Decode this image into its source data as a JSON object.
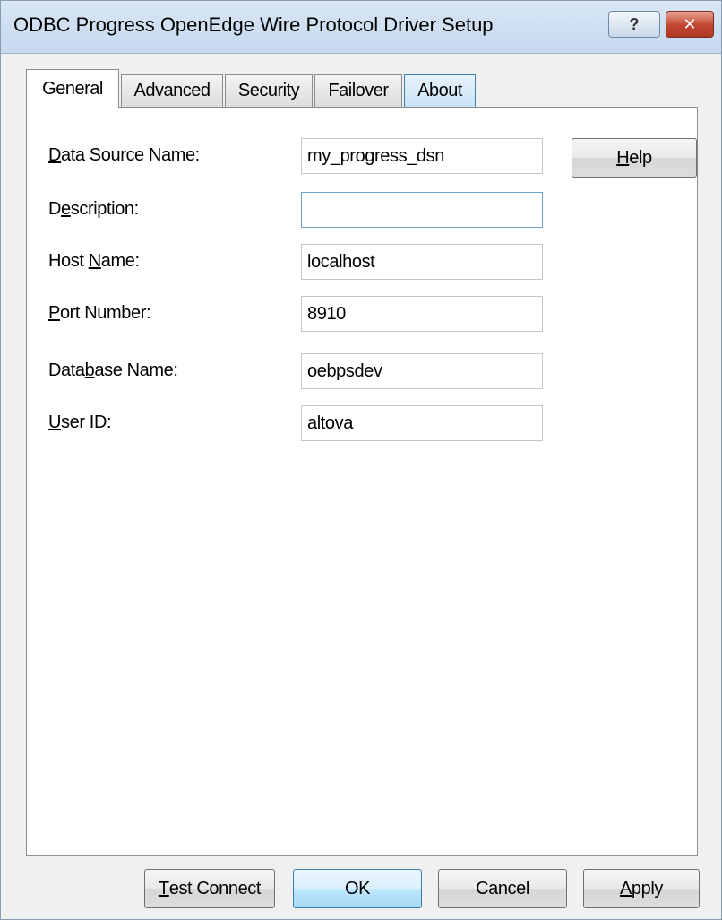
{
  "window": {
    "title": "ODBC Progress OpenEdge Wire Protocol Driver Setup",
    "help_glyph": "?",
    "close_glyph": "✕"
  },
  "tabs": [
    {
      "label": "General",
      "active": true
    },
    {
      "label": "Advanced",
      "active": false
    },
    {
      "label": "Security",
      "active": false
    },
    {
      "label": "Failover",
      "active": false
    },
    {
      "label": "About",
      "active": false
    }
  ],
  "form": {
    "data_source_name": {
      "mn": "D",
      "rest": "ata Source Name:",
      "value": "my_progress_dsn"
    },
    "description": {
      "pre": "D",
      "mn": "e",
      "rest": "scription:",
      "value": ""
    },
    "host_name": {
      "pre": "Host ",
      "mn": "N",
      "rest": "ame:",
      "value": "localhost"
    },
    "port_number": {
      "mn": "P",
      "rest": "ort Number:",
      "value": "8910"
    },
    "database_name": {
      "pre": "Data",
      "mn": "b",
      "rest": "ase Name:",
      "value": "oebpsdev"
    },
    "user_id": {
      "mn": "U",
      "rest": "ser ID:",
      "value": "altova"
    }
  },
  "help_button": {
    "mn": "H",
    "rest": "elp"
  },
  "footer": {
    "test_connect": {
      "mn": "T",
      "rest": "est Connect"
    },
    "ok": "OK",
    "cancel": "Cancel",
    "apply": {
      "mn": "A",
      "rest": "pply"
    }
  },
  "colors": {
    "title_bar": "#c5d8ee",
    "close_button": "#c14530",
    "default_button": "#bee6fd",
    "dialog_bg": "#f0f0f0"
  }
}
